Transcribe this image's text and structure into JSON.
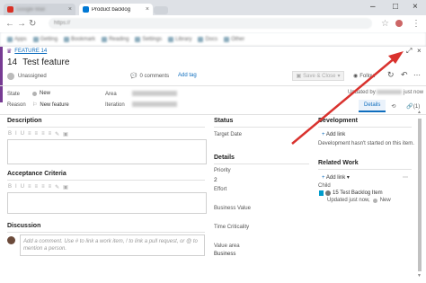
{
  "browser": {
    "tabs": [
      {
        "label": "Google Mail",
        "active": false
      },
      {
        "label": "Product backlog",
        "active": true
      }
    ],
    "address": "https://",
    "bookmarks": [
      "Apps",
      "Getting",
      "Bookmark",
      "Reading",
      "Settings",
      "Library",
      "Docs",
      "Other"
    ]
  },
  "work_item": {
    "type_label": "FEATURE 14",
    "id": "14",
    "title": "Test feature",
    "assigned": "Unassigned",
    "comments": "0 comments",
    "add_tag": "Add tag",
    "save_close": "Save & Close",
    "follow": "Follow",
    "updated_by": "Updated by",
    "updated_when": "just now",
    "state_label": "State",
    "state_value": "New",
    "reason_label": "Reason",
    "reason_value": "New feature",
    "area_label": "Area",
    "iteration_label": "Iteration",
    "details_tab": "Details",
    "history_count": "",
    "links_count": "(1)",
    "attach_count": "",
    "colors": {
      "accent": "#106ebe",
      "feature": "#773b93",
      "state_new": "#b2b2b2",
      "arrow": "#d9322e"
    }
  },
  "left": {
    "description": "Description",
    "acceptance": "Acceptance Criteria",
    "discussion": "Discussion",
    "toolbar": [
      "B",
      "I",
      "U",
      "≡",
      "≡",
      "≡",
      "≡",
      "✎",
      "▣"
    ],
    "comment_placeholder": "Add a comment. Use # to link a work item, ! to link a pull request, or @ to mention a person."
  },
  "middle": {
    "status": "Status",
    "target_date": "Target Date",
    "details": "Details",
    "priority_label": "Priority",
    "priority_value": "2",
    "effort_label": "Effort",
    "business_value_label": "Business Value",
    "time_criticality_label": "Time Criticality",
    "value_area_label": "Value area",
    "value_area_value": "Business"
  },
  "right": {
    "development": "Development",
    "add_link": "Add link",
    "dev_note": "Development hasn't started on this item.",
    "related_work": "Related Work",
    "add_link_dd": "Add link",
    "child_label": "Child",
    "child_item": "15 Test Backlog Item",
    "child_meta": "Updated just now,",
    "child_state": "New"
  }
}
